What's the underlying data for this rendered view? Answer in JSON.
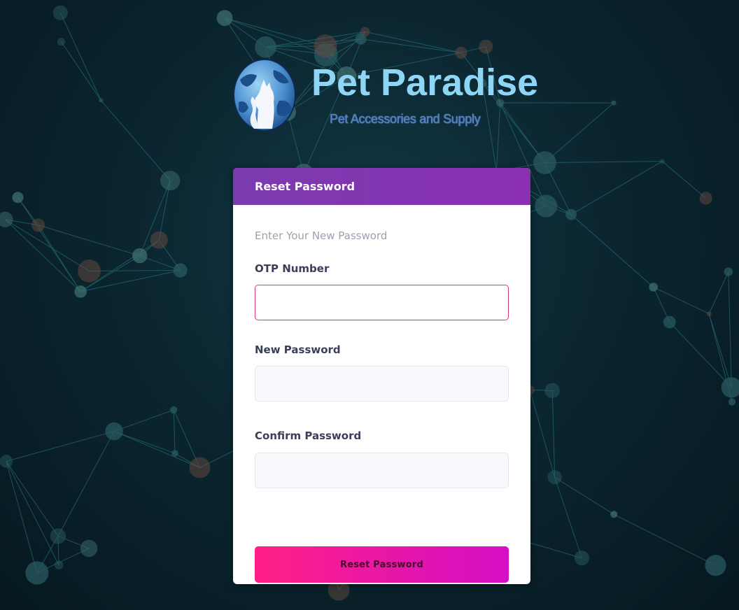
{
  "brand": {
    "name": "Pet Paradise",
    "tagline": "Pet Accessories and Supply"
  },
  "card": {
    "title": "Reset Password",
    "subtitle": "Enter Your New Password",
    "fields": [
      {
        "label": "OTP Number",
        "value": "",
        "placeholder": ""
      },
      {
        "label": "New Password",
        "value": "",
        "placeholder": ""
      },
      {
        "label": "Confirm Password",
        "value": "",
        "placeholder": ""
      }
    ],
    "submit_label": "Reset Password"
  },
  "colors": {
    "header": "#7b3bb0",
    "button_start": "#ff1f85",
    "button_end": "#d40fc6",
    "brand_text": "#8fd6f6",
    "focus_border": "#e0347d"
  }
}
